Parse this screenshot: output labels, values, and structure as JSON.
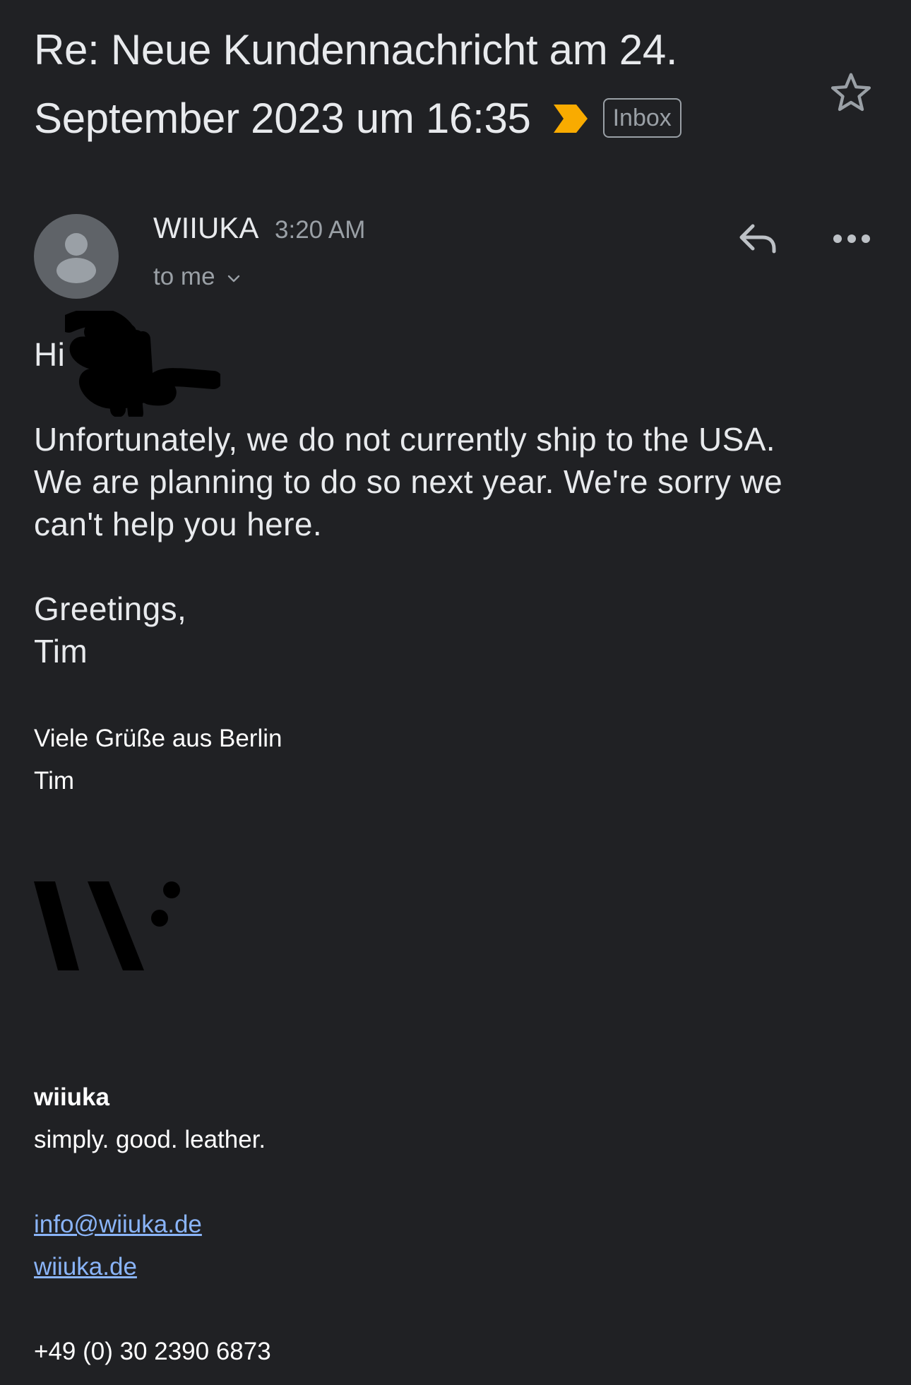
{
  "email": {
    "subject": "Re: Neue Kundennachricht am 24. September 2023 um 16:35",
    "label": "Inbox",
    "colors": {
      "background": "#202124",
      "importance_marker": "#f9ab00",
      "link": "#8ab4f8"
    },
    "sender": {
      "name": "WIIUKA",
      "time": "3:20 AM",
      "recipient": "to me"
    },
    "body": {
      "greeting": "Hi",
      "paragraph_1": "Unfortunately, we do not currently ship to the USA. We are planning to do so next year. We're sorry we can't help you here.",
      "closing": "Greetings,",
      "name": "Tim"
    },
    "signature": {
      "line_1": "Viele Grüße aus Berlin",
      "line_2": "Tim",
      "logo": "wiiuka-logo",
      "company": "wiiuka",
      "tagline": "simply. good. leather.",
      "email": "info@wiiuka.de",
      "website": "wiiuka.de",
      "phone": "+49 (0) 30 2390 6873"
    }
  },
  "icons": {
    "importance": "importance-marker-icon",
    "star": "star-outline-icon",
    "avatar": "person-icon",
    "chevron": "chevron-down-icon",
    "reply": "reply-icon",
    "more": "more-horizontal-icon"
  }
}
